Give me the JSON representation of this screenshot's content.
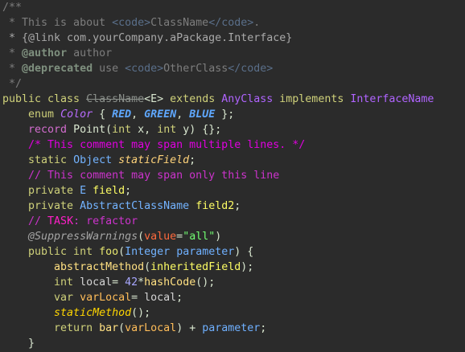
{
  "editor": {
    "lines": [
      [
        {
          "t": "/**",
          "c": "doc"
        }
      ],
      [
        {
          "t": " * This is about ",
          "c": "doc"
        },
        {
          "t": "<code>",
          "c": "doc-html"
        },
        {
          "t": "ClassName",
          "c": "doc"
        },
        {
          "t": "</code>",
          "c": "doc-html"
        },
        {
          "t": ".",
          "c": "doc"
        }
      ],
      [
        {
          "t": " * {@link com.yourCompany.aPackage.Interface}",
          "c": "doc-link"
        }
      ],
      [
        {
          "t": " * ",
          "c": "doc"
        },
        {
          "t": "@author",
          "c": "doc-tag"
        },
        {
          "t": " author",
          "c": "doc"
        }
      ],
      [
        {
          "t": " * ",
          "c": "doc"
        },
        {
          "t": "@deprecated",
          "c": "doc-tag"
        },
        {
          "t": " use ",
          "c": "doc"
        },
        {
          "t": "<code>",
          "c": "doc-html"
        },
        {
          "t": "OtherClass",
          "c": "doc"
        },
        {
          "t": "</code>",
          "c": "doc-html"
        }
      ],
      [
        {
          "t": " */",
          "c": "doc"
        }
      ],
      [
        {
          "t": "public class ",
          "c": "kw"
        },
        {
          "t": "ClassName",
          "c": "deprecated"
        },
        {
          "t": "<E> ",
          "c": "plain"
        },
        {
          "t": "extends ",
          "c": "kw"
        },
        {
          "t": "AnyClass ",
          "c": "type-purple"
        },
        {
          "t": "implements ",
          "c": "kw"
        },
        {
          "t": "InterfaceName",
          "c": "type-purple"
        }
      ],
      [
        {
          "t": "    enum ",
          "c": "kw"
        },
        {
          "t": "Color",
          "c": "enum-name"
        },
        {
          "t": " { ",
          "c": "plain"
        },
        {
          "t": "RED",
          "c": "enum-const"
        },
        {
          "t": ", ",
          "c": "plain"
        },
        {
          "t": "GREEN",
          "c": "enum-const"
        },
        {
          "t": ", ",
          "c": "plain"
        },
        {
          "t": "BLUE",
          "c": "enum-const"
        },
        {
          "t": " };",
          "c": "plain"
        }
      ],
      [
        {
          "t": "    ",
          "c": "plain"
        },
        {
          "t": "record ",
          "c": "rec"
        },
        {
          "t": "Point",
          "c": "plain"
        },
        {
          "t": "(",
          "c": "plain"
        },
        {
          "t": "int ",
          "c": "kw"
        },
        {
          "t": "x, ",
          "c": "plain"
        },
        {
          "t": "int ",
          "c": "kw"
        },
        {
          "t": "y) {};",
          "c": "plain"
        }
      ],
      [
        {
          "t": "    /* This comment may span multiple lines. */",
          "c": "comment-block"
        }
      ],
      [
        {
          "t": "    static ",
          "c": "kw"
        },
        {
          "t": "Object ",
          "c": "type-blue"
        },
        {
          "t": "staticField",
          "c": "static-field"
        },
        {
          "t": ";",
          "c": "plain"
        }
      ],
      [
        {
          "t": "    // This comment may span only this line",
          "c": "comment-line"
        }
      ],
      [
        {
          "t": "    private ",
          "c": "kw"
        },
        {
          "t": "E ",
          "c": "type-blue"
        },
        {
          "t": "field",
          "c": "field"
        },
        {
          "t": ";",
          "c": "plain"
        }
      ],
      [
        {
          "t": "    private ",
          "c": "kw"
        },
        {
          "t": "AbstractClassName ",
          "c": "type-blue"
        },
        {
          "t": "field2",
          "c": "field"
        },
        {
          "t": ";",
          "c": "plain"
        }
      ],
      [
        {
          "t": "    // ",
          "c": "comment-line"
        },
        {
          "t": "TASK",
          "c": "todo"
        },
        {
          "t": ": refactor",
          "c": "comment-line"
        }
      ],
      [
        {
          "t": "    @SuppressWarnings",
          "c": "annotation"
        },
        {
          "t": "(",
          "c": "plain"
        },
        {
          "t": "value",
          "c": "attr"
        },
        {
          "t": "=",
          "c": "plain"
        },
        {
          "t": "\"all\"",
          "c": "string"
        },
        {
          "t": ")",
          "c": "plain"
        }
      ],
      [
        {
          "t": "    public int ",
          "c": "kw"
        },
        {
          "t": "foo",
          "c": "method"
        },
        {
          "t": "(",
          "c": "plain"
        },
        {
          "t": "Integer ",
          "c": "type-blue"
        },
        {
          "t": "parameter",
          "c": "param"
        },
        {
          "t": ") {",
          "c": "plain"
        }
      ],
      [
        {
          "t": "        abstractMethod",
          "c": "func-call"
        },
        {
          "t": "(",
          "c": "plain"
        },
        {
          "t": "inheritedField",
          "c": "field"
        },
        {
          "t": ");",
          "c": "plain"
        }
      ],
      [
        {
          "t": "        int ",
          "c": "kw"
        },
        {
          "t": "local",
          "c": "local"
        },
        {
          "t": "= ",
          "c": "plain"
        },
        {
          "t": "42",
          "c": "number"
        },
        {
          "t": "*",
          "c": "op"
        },
        {
          "t": "hashCode",
          "c": "func-call"
        },
        {
          "t": "();",
          "c": "plain"
        }
      ],
      [
        {
          "t": "        var ",
          "c": "kw"
        },
        {
          "t": "varLocal",
          "c": "var-local"
        },
        {
          "t": "= ",
          "c": "plain"
        },
        {
          "t": "local",
          "c": "local"
        },
        {
          "t": ";",
          "c": "plain"
        }
      ],
      [
        {
          "t": "        staticMethod",
          "c": "static-method"
        },
        {
          "t": "();",
          "c": "plain"
        }
      ],
      [
        {
          "t": "        return ",
          "c": "kw"
        },
        {
          "t": "bar",
          "c": "func-call"
        },
        {
          "t": "(",
          "c": "plain"
        },
        {
          "t": "varLocal",
          "c": "var-local"
        },
        {
          "t": ") + ",
          "c": "plain"
        },
        {
          "t": "parameter",
          "c": "param"
        },
        {
          "t": ";",
          "c": "plain"
        }
      ],
      [
        {
          "t": "    }",
          "c": "plain"
        }
      ]
    ]
  }
}
